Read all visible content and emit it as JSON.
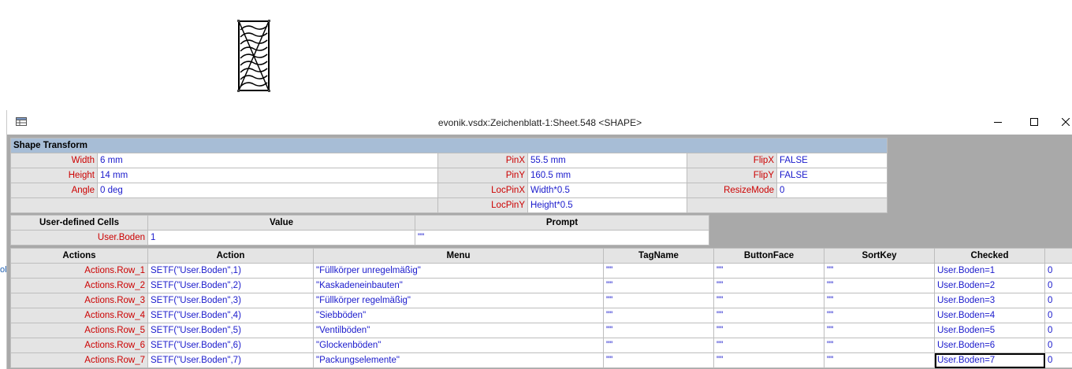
{
  "window": {
    "title": "evonik.vsdx:Zeichenblatt-1:Sheet.548 <SHAPE>"
  },
  "edge_fragment": "ol",
  "shape_transform": {
    "header": "Shape Transform",
    "rows": [
      [
        {
          "label": "Width",
          "value": "6 mm"
        },
        {
          "label": "PinX",
          "value": "55.5 mm"
        },
        {
          "label": "FlipX",
          "value": "FALSE"
        }
      ],
      [
        {
          "label": "Height",
          "value": "14 mm"
        },
        {
          "label": "PinY",
          "value": "160.5 mm"
        },
        {
          "label": "FlipY",
          "value": "FALSE"
        }
      ],
      [
        {
          "label": "Angle",
          "value": "0 deg"
        },
        {
          "label": "LocPinX",
          "value": "Width*0.5"
        },
        {
          "label": "ResizeMode",
          "value": "0"
        }
      ],
      [
        {
          "label": "",
          "value": ""
        },
        {
          "label": "LocPinY",
          "value": "Height*0.5"
        },
        {
          "label": "",
          "value": ""
        }
      ]
    ]
  },
  "user_defined": {
    "header": "User-defined Cells",
    "columns": [
      "Value",
      "Prompt"
    ],
    "rows": [
      {
        "label": "User.Boden",
        "cells": [
          "1",
          "\"\""
        ]
      }
    ]
  },
  "actions": {
    "header": "Actions",
    "columns": [
      "Action",
      "Menu",
      "TagName",
      "ButtonFace",
      "SortKey",
      "Checked"
    ],
    "rows": [
      {
        "label": "Actions.Row_1",
        "cells": [
          "SETF(\"User.Boden\",1)",
          "\"Füllkörper unregelmäßig\"",
          "\"\"",
          "\"\"",
          "\"\"",
          "User.Boden=1",
          "0"
        ]
      },
      {
        "label": "Actions.Row_2",
        "cells": [
          "SETF(\"User.Boden\",2)",
          "\"Kaskadeneinbauten\"",
          "\"\"",
          "\"\"",
          "\"\"",
          "User.Boden=2",
          "0"
        ]
      },
      {
        "label": "Actions.Row_3",
        "cells": [
          "SETF(\"User.Boden\",3)",
          "\"Füllkörper regelmäßig\"",
          "\"\"",
          "\"\"",
          "\"\"",
          "User.Boden=3",
          "0"
        ]
      },
      {
        "label": "Actions.Row_4",
        "cells": [
          "SETF(\"User.Boden\",4)",
          "\"Siebböden\"",
          "\"\"",
          "\"\"",
          "\"\"",
          "User.Boden=4",
          "0"
        ]
      },
      {
        "label": "Actions.Row_5",
        "cells": [
          "SETF(\"User.Boden\",5)",
          "\"Ventilböden\"",
          "\"\"",
          "\"\"",
          "\"\"",
          "User.Boden=5",
          "0"
        ]
      },
      {
        "label": "Actions.Row_6",
        "cells": [
          "SETF(\"User.Boden\",6)",
          "\"Glockenböden\"",
          "\"\"",
          "\"\"",
          "\"\"",
          "User.Boden=6",
          "0"
        ]
      },
      {
        "label": "Actions.Row_7",
        "cells": [
          "SETF(\"User.Boden\",7)",
          "\"Packungselemente\"",
          "\"\"",
          "\"\"",
          "\"\"",
          "User.Boden=7",
          "0"
        ]
      }
    ]
  }
}
